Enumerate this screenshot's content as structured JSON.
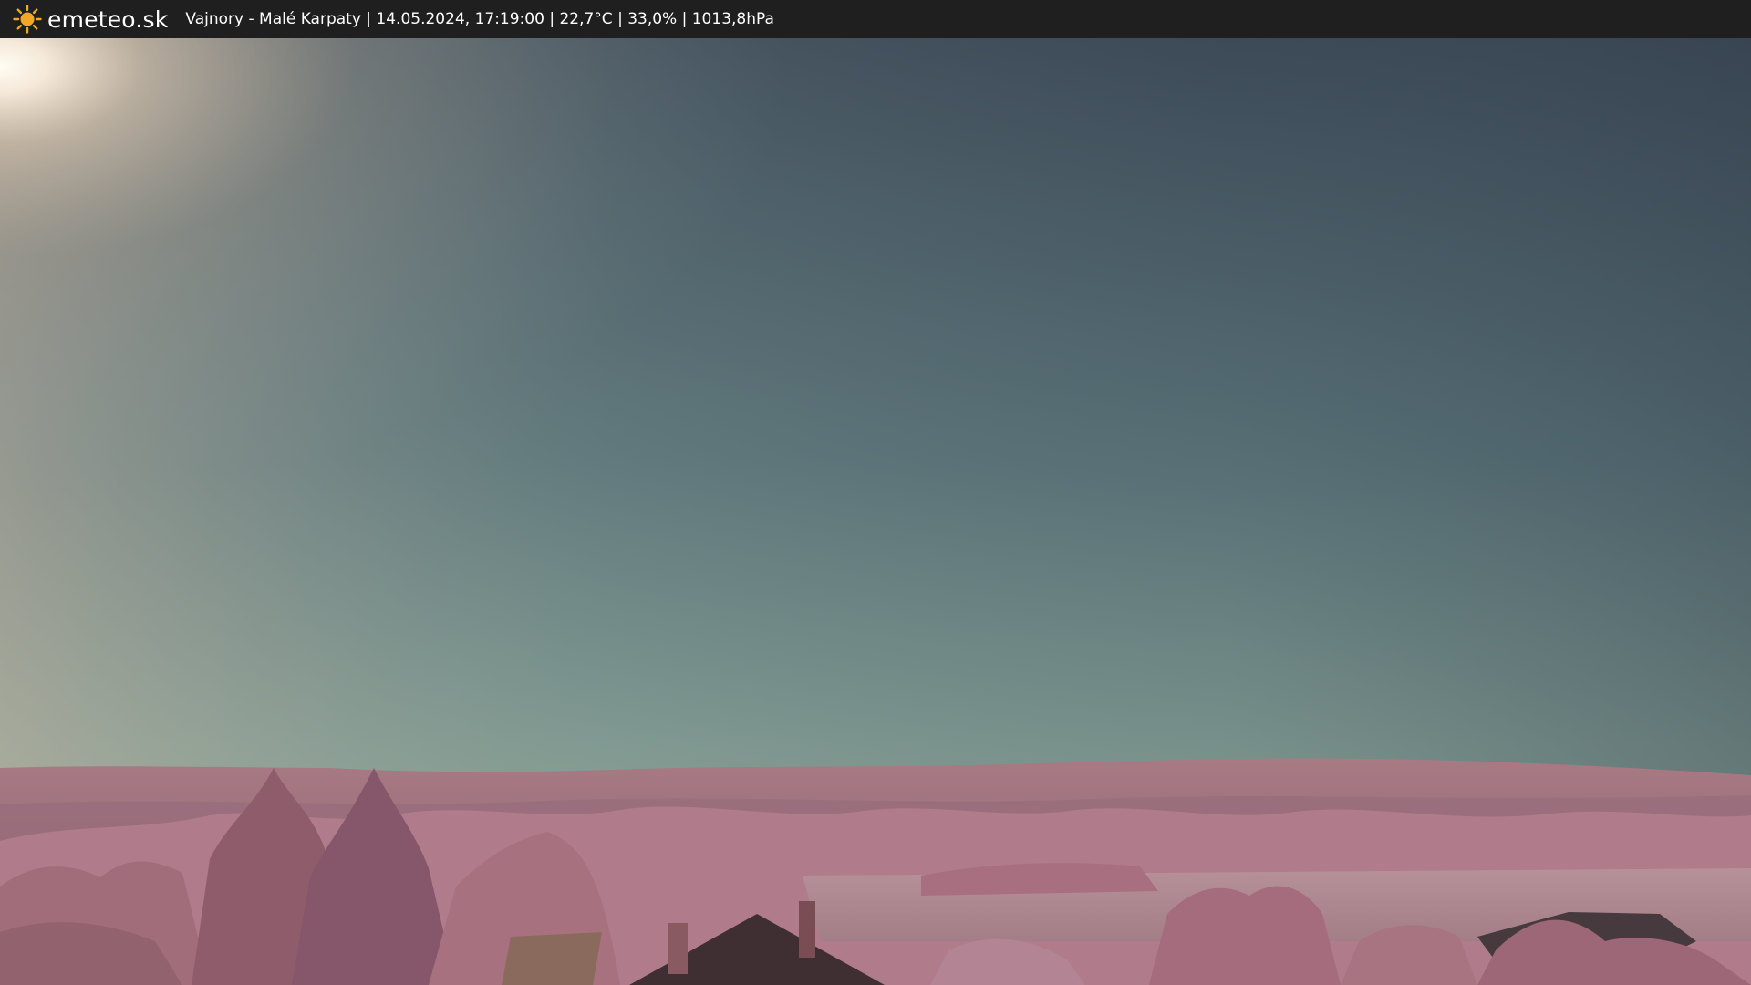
{
  "header": {
    "brand": "emeteo.sk",
    "logo_icon": "sun-icon",
    "caption": "Vajnory - Malé Karpaty | 14.05.2024, 17:19:00 | 22,7°C | 33,0% | 1013,8hPa"
  },
  "colors": {
    "bar_background": "#1f1f1f",
    "sun_logo": "#f5a623",
    "sky_top": "#3a4756",
    "sky_horizon": "#94ab97",
    "hills": "#9a6d78",
    "foliage": "#b37d8c"
  }
}
